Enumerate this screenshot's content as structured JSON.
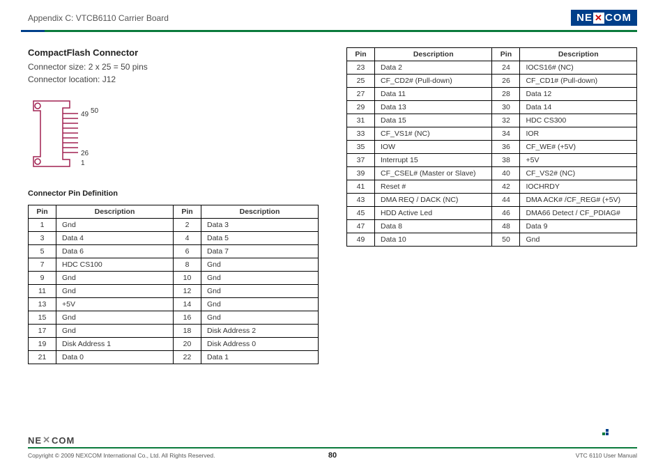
{
  "header": {
    "appendix": "Appendix C: VTCB6110 Carrier Board",
    "brand": "NEXCOM"
  },
  "section": {
    "title": "CompactFlash Connector",
    "size_line": "Connector size: 2 x 25 = 50 pins",
    "location_line": "Connector location: J12",
    "diagram_labels": {
      "top_right": "50",
      "top_left": "49",
      "bottom_right": "26",
      "bottom_left": "1"
    },
    "pin_def_heading": "Connector Pin Definition"
  },
  "table_headers": {
    "pin": "Pin",
    "desc": "Description"
  },
  "pins_left": [
    {
      "p1": "1",
      "d1": "Gnd",
      "p2": "2",
      "d2": "Data 3"
    },
    {
      "p1": "3",
      "d1": "Data 4",
      "p2": "4",
      "d2": "Data 5"
    },
    {
      "p1": "5",
      "d1": "Data 6",
      "p2": "6",
      "d2": "Data 7"
    },
    {
      "p1": "7",
      "d1": "HDC CS100",
      "p2": "8",
      "d2": "Gnd"
    },
    {
      "p1": "9",
      "d1": "Gnd",
      "p2": "10",
      "d2": "Gnd"
    },
    {
      "p1": "11",
      "d1": "Gnd",
      "p2": "12",
      "d2": "Gnd"
    },
    {
      "p1": "13",
      "d1": "+5V",
      "p2": "14",
      "d2": "Gnd"
    },
    {
      "p1": "15",
      "d1": "Gnd",
      "p2": "16",
      "d2": "Gnd"
    },
    {
      "p1": "17",
      "d1": "Gnd",
      "p2": "18",
      "d2": "Disk Address 2"
    },
    {
      "p1": "19",
      "d1": "Disk Address 1",
      "p2": "20",
      "d2": "Disk Address 0"
    },
    {
      "p1": "21",
      "d1": "Data 0",
      "p2": "22",
      "d2": "Data 1"
    }
  ],
  "pins_right": [
    {
      "p1": "23",
      "d1": "Data 2",
      "p2": "24",
      "d2": "IOCS16# (NC)"
    },
    {
      "p1": "25",
      "d1": "CF_CD2# (Pull-down)",
      "p2": "26",
      "d2": "CF_CD1# (Pull-down)"
    },
    {
      "p1": "27",
      "d1": "Data 11",
      "p2": "28",
      "d2": "Data 12"
    },
    {
      "p1": "29",
      "d1": "Data 13",
      "p2": "30",
      "d2": "Data 14"
    },
    {
      "p1": "31",
      "d1": "Data 15",
      "p2": "32",
      "d2": "HDC CS300"
    },
    {
      "p1": "33",
      "d1": "CF_VS1# (NC)",
      "p2": "34",
      "d2": "IOR"
    },
    {
      "p1": "35",
      "d1": "IOW",
      "p2": "36",
      "d2": "CF_WE# (+5V)"
    },
    {
      "p1": "37",
      "d1": "Interrupt 15",
      "p2": "38",
      "d2": "+5V"
    },
    {
      "p1": "39",
      "d1": "CF_CSEL# (Master or Slave)",
      "p2": "40",
      "d2": "CF_VS2# (NC)"
    },
    {
      "p1": "41",
      "d1": "Reset #",
      "p2": "42",
      "d2": "IOCHRDY"
    },
    {
      "p1": "43",
      "d1": "DMA REQ / DACK (NC)",
      "p2": "44",
      "d2": "DMA ACK# /CF_REG# (+5V)"
    },
    {
      "p1": "45",
      "d1": "HDD Active Led",
      "p2": "46",
      "d2": "DMA66 Detect / CF_PDIAG#"
    },
    {
      "p1": "47",
      "d1": "Data 8",
      "p2": "48",
      "d2": "Data 9"
    },
    {
      "p1": "49",
      "d1": "Data 10",
      "p2": "50",
      "d2": "Gnd"
    }
  ],
  "footer": {
    "copyright": "Copyright © 2009 NEXCOM International Co., Ltd. All Rights Reserved.",
    "page": "80",
    "manual": "VTC 6110 User Manual",
    "brand": "NEXCOM"
  }
}
